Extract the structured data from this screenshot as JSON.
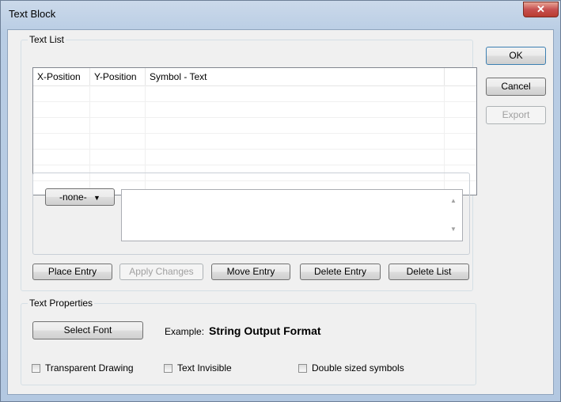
{
  "window": {
    "title": "Text Block",
    "close_glyph": "✕"
  },
  "text_list": {
    "group_label": "Text List",
    "columns": [
      "X-Position",
      "Y-Position",
      "Symbol - Text"
    ]
  },
  "entry": {
    "symbol_select_value": "-none-",
    "text_value": ""
  },
  "list_buttons": {
    "place": "Place Entry",
    "apply": "Apply Changes",
    "move": "Move Entry",
    "delete": "Delete Entry",
    "delete_list": "Delete List"
  },
  "dialog_buttons": {
    "ok": "OK",
    "cancel": "Cancel",
    "export": "Export"
  },
  "text_properties": {
    "group_label": "Text Properties",
    "select_font": "Select Font",
    "example_label": "Example:",
    "example_text": "String Output Format",
    "transparent": "Transparent Drawing",
    "invisible": "Text Invisible",
    "double": "Double sized symbols"
  }
}
